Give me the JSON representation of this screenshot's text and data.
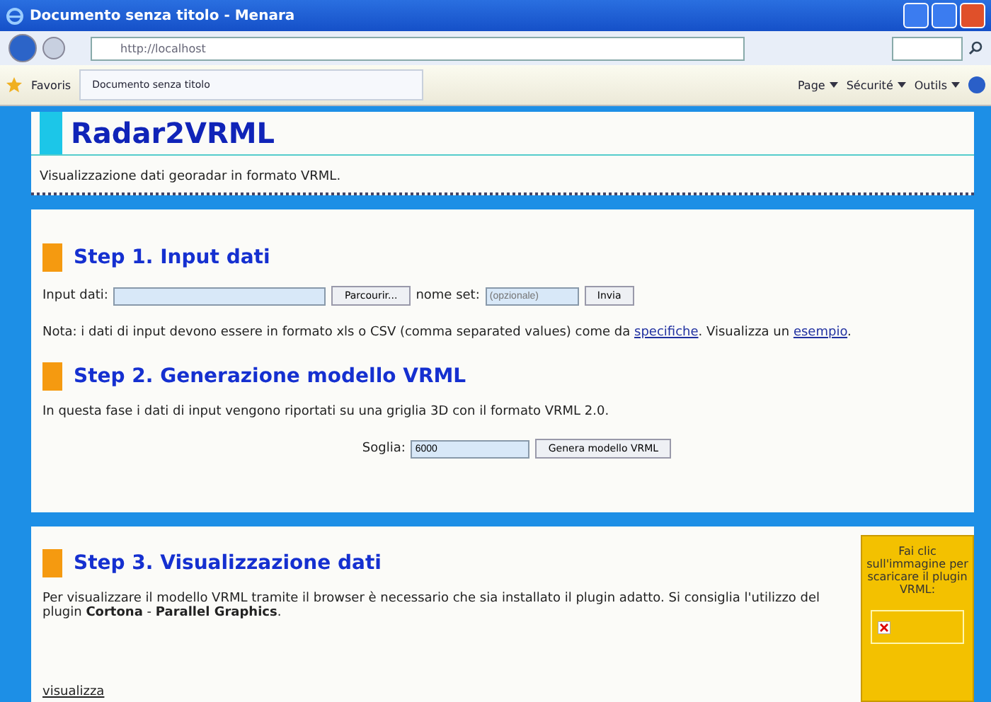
{
  "window": {
    "title": "Documento senza titolo - Menara"
  },
  "address_bar": {
    "url": "http://localhost"
  },
  "favorites_bar": {
    "favorites": "Favoris",
    "tab": "Documento senza titolo",
    "commands": [
      "Page",
      "Sécurité",
      "Outils"
    ]
  },
  "header": {
    "title": "Radar2VRML",
    "subtitle": "Visualizzazione dati georadar in formato VRML."
  },
  "step1": {
    "heading": "Step 1. Input dati",
    "input_label": "Input dati:",
    "browse_button": "Parcourir...",
    "name_label": "nome set:",
    "name_placeholder": "(opzionale)",
    "send_button": "Invia",
    "note_parts": [
      "Nota: i dati di input devono essere in formato xls o CSV (comma separated values) come da ",
      ". Visualizza un ",
      "."
    ],
    "links": [
      "specifiche",
      "esempio"
    ]
  },
  "step2": {
    "heading": "Step 2. Generazione modello VRML",
    "description": "In questa fase i dati di input vengono riportati su una griglia 3D con il formato VRML 2.0.",
    "threshold_label": "Soglia:",
    "threshold_value": "6000",
    "generate_button": "Genera modello VRML"
  },
  "step3": {
    "heading": "Step 3. Visualizzazione dati",
    "description": "Per visualizzare il modello VRML tramite il browser è necessario che sia installato il plugin adatto. Si consiglia l'utilizzo del plugin **Cortona** - **Parallel Graphics**.",
    "link": "visualizza",
    "plugin_note": "Fai clic sull'immagine per scaricare il plugin VRML:"
  }
}
